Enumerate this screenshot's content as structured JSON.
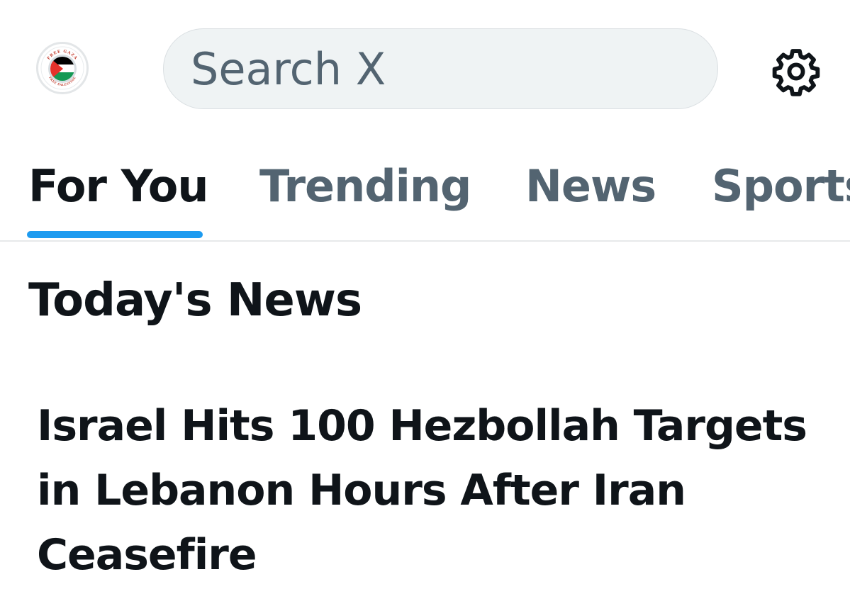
{
  "header": {
    "avatar_icon": "palestine-flag-avatar-icon",
    "avatar_text_top": "FREE GAZA",
    "avatar_text_bottom": "FREE PALESTINE",
    "search_placeholder": "Search X",
    "settings_icon": "gear-icon"
  },
  "tabs": [
    {
      "label": "For You",
      "active": true
    },
    {
      "label": "Trending",
      "active": false
    },
    {
      "label": "News",
      "active": false
    },
    {
      "label": "Sports",
      "active": false
    }
  ],
  "section": {
    "title": "Today's News"
  },
  "news_items": [
    {
      "headline": "Israel Hits 100 Hezbollah Targets in Lebanon Hours After Iran Ceasefire"
    }
  ],
  "colors": {
    "accent": "#1d9bf0",
    "text_primary": "#0f1419",
    "text_secondary": "#536471",
    "search_bg": "#eff3f4"
  }
}
